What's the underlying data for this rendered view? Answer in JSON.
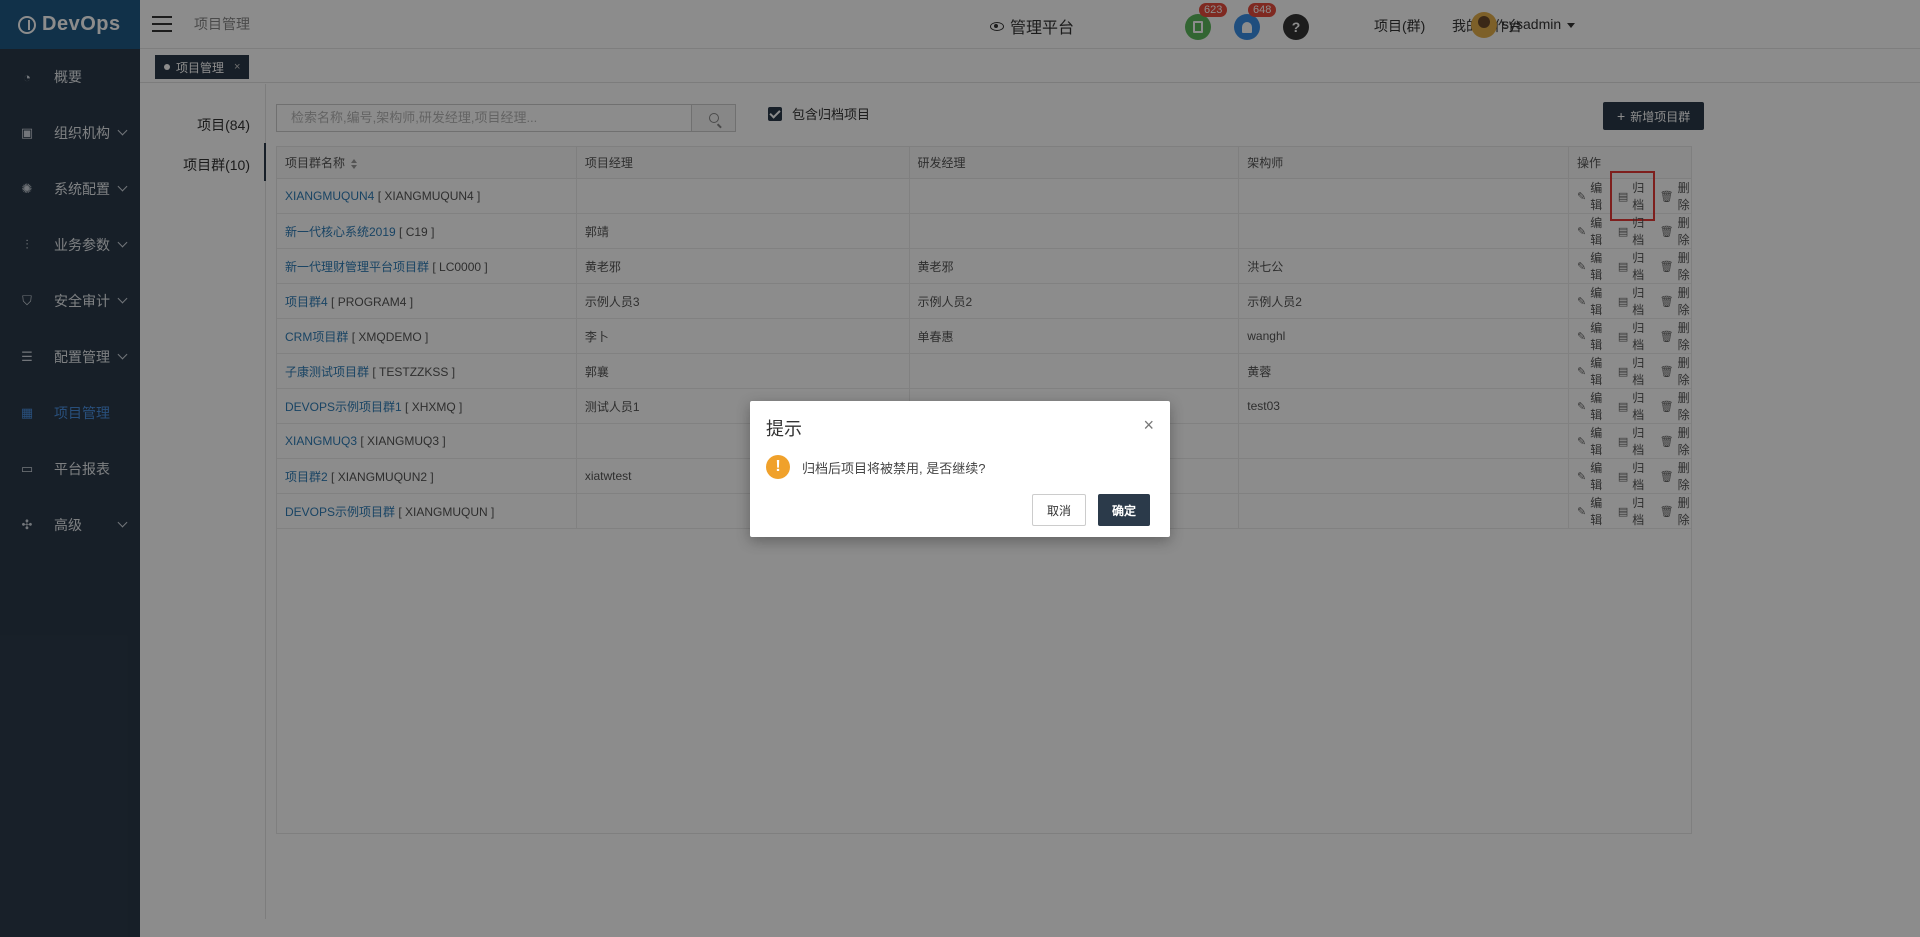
{
  "app": {
    "logo_text": "DevOps"
  },
  "header": {
    "breadcrumb": "项目管理",
    "center_title": "管理平台",
    "doc_badge": "623",
    "bell_badge": "648",
    "help_glyph": "?",
    "link_project_group": "项目(群)",
    "link_workbench": "我的工作台",
    "username": "sysadmin"
  },
  "sidebar": {
    "items": [
      {
        "label": "概要",
        "icon": "dashboard-icon"
      },
      {
        "label": "组织机构",
        "icon": "lock-icon"
      },
      {
        "label": "系统配置",
        "icon": "gear-icon"
      },
      {
        "label": "业务参数",
        "icon": "sliders-icon"
      },
      {
        "label": "安全审计",
        "icon": "shield-icon"
      },
      {
        "label": "配置管理",
        "icon": "database-icon"
      },
      {
        "label": "项目管理",
        "icon": "grid-icon"
      },
      {
        "label": "平台报表",
        "icon": "monitor-icon"
      },
      {
        "label": "高级",
        "icon": "advanced-icon"
      }
    ]
  },
  "tabstrip": {
    "active_tab": "项目管理",
    "close": "×"
  },
  "side_tabs": {
    "projects": "项目(84)",
    "groups": "项目群(10)"
  },
  "toolbar": {
    "search_placeholder": "检索名称,编号,架构师,研发经理,项目经理...",
    "include_archived": "包含归档项目",
    "add_group": "新增项目群"
  },
  "table": {
    "headers": [
      "项目群名称",
      "项目经理",
      "研发经理",
      "架构师",
      "操作"
    ],
    "ops": {
      "edit": "编辑",
      "archive": "归档",
      "delete": "删除"
    },
    "rows": [
      {
        "name": "XIANGMUQUN4",
        "code": "[ XIANGMUQUN4 ]",
        "pm": "",
        "rd": "",
        "arch": ""
      },
      {
        "name": "新一代核心系统2019",
        "code": "[ C19 ]",
        "pm": "郭靖",
        "rd": "",
        "arch": ""
      },
      {
        "name": "新一代理财管理平台项目群",
        "code": "[ LC0000 ]",
        "pm": "黄老邪",
        "rd": "黄老邪",
        "arch": "洪七公"
      },
      {
        "name": "项目群4",
        "code": "[ PROGRAM4 ]",
        "pm": "示例人员3",
        "rd": "示例人员2",
        "arch": "示例人员2"
      },
      {
        "name": "CRM项目群",
        "code": "[ XMQDEMO ]",
        "pm": "李卜",
        "rd": "单春惠",
        "arch": "wanghl"
      },
      {
        "name": "子康测试项目群",
        "code": "[ TESTZZKSS ]",
        "pm": "郭襄",
        "rd": "",
        "arch": "黄蓉"
      },
      {
        "name": "DEVOPS示例项目群1",
        "code": "[ XHXMQ ]",
        "pm": "测试人员1",
        "rd": "",
        "arch": "test03"
      },
      {
        "name": "XIANGMUQ3",
        "code": "[ XIANGMUQ3 ]",
        "pm": "",
        "rd": "",
        "arch": ""
      },
      {
        "name": "项目群2",
        "code": "[ XIANGMUQUN2 ]",
        "pm": "xiatwtest",
        "rd": "",
        "arch": ""
      },
      {
        "name": "DEVOPS示例项目群",
        "code": "[ XIANGMUQUN ]",
        "pm": "",
        "rd": "",
        "arch": ""
      }
    ]
  },
  "dialog": {
    "title": "提示",
    "close": "×",
    "message": "归档后项目将被禁用, 是否继续?",
    "warn_glyph": "!",
    "cancel": "取消",
    "confirm": "确定"
  }
}
